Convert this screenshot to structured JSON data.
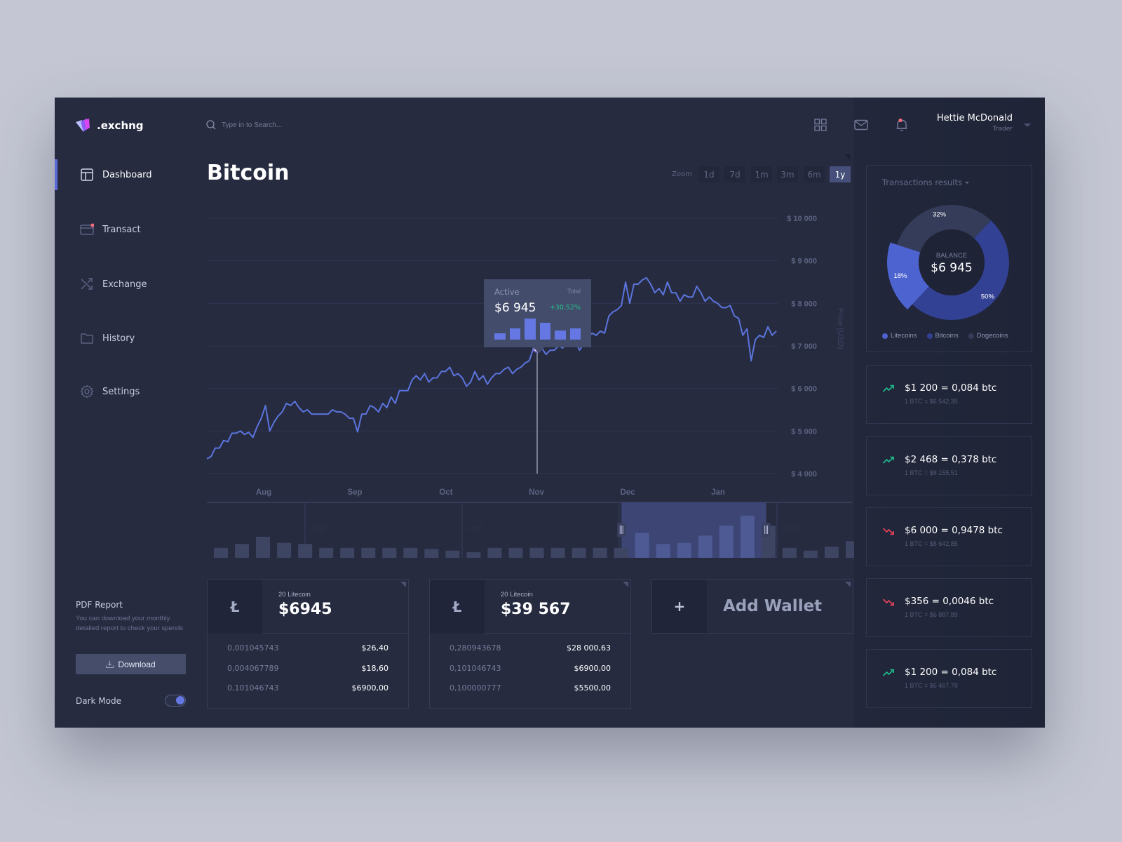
{
  "brand": {
    "name": ".exchng"
  },
  "search": {
    "placeholder": "Type in to Search..."
  },
  "header": {
    "icons": [
      "grid-icon",
      "mail-icon",
      "bell-icon"
    ],
    "user": {
      "name": "Hettie McDonald",
      "role": "Trader"
    }
  },
  "sidebar": {
    "items": [
      {
        "label": "Dashboard",
        "icon": "dashboard-icon",
        "active": true
      },
      {
        "label": "Transact",
        "icon": "card-icon",
        "badge": true
      },
      {
        "label": "Exchange",
        "icon": "shuffle-icon"
      },
      {
        "label": "History",
        "icon": "folder-icon"
      },
      {
        "label": "Settings",
        "icon": "gear-icon"
      }
    ],
    "pdf": {
      "title": "PDF Report",
      "description": "You can download your monthly detailed report to check your spends",
      "button": "Download"
    },
    "dark_mode": {
      "label": "Dark Mode",
      "on": true
    }
  },
  "main": {
    "title": "Bitcoin",
    "zoom": {
      "label": "Zoom",
      "options": [
        "1d",
        "7d",
        "1m",
        "3m",
        "6m",
        "1y"
      ],
      "selected": "1y"
    },
    "tooltip": {
      "label": "Active",
      "total_label": "Total",
      "value": "$6 945",
      "change": "+30.52%",
      "bars": [
        0.3,
        0.55,
        1.0,
        0.8,
        0.42,
        0.55
      ]
    }
  },
  "chart_data": {
    "type": "line",
    "title": "Bitcoin",
    "ylabel": "Price (USD)",
    "xlabel": "",
    "x_ticks": [
      "Aug",
      "Sep",
      "Oct",
      "Nov",
      "Dec",
      "Jan"
    ],
    "y_ticks": [
      "$ 10 000",
      "$ 9 000",
      "$ 8 000",
      "$ 7 000",
      "$ 6 000",
      "$ 5 000",
      "$ 4 000"
    ],
    "ylim": [
      4000,
      10000
    ],
    "grid": true,
    "highlight": {
      "month_position": 3.0,
      "value": 6945
    },
    "series": [
      {
        "name": "BTC",
        "color": "#5b74dc",
        "values": [
          4350,
          4400,
          4600,
          4600,
          4780,
          4750,
          4950,
          4950,
          5000,
          4920,
          4970,
          4850,
          5100,
          5300,
          5600,
          5000,
          5200,
          5350,
          5450,
          5650,
          5600,
          5700,
          5550,
          5450,
          5500,
          5400,
          5400,
          5400,
          5400,
          5400,
          5500,
          5450,
          5450,
          5400,
          5300,
          5300,
          4980,
          5400,
          5400,
          5600,
          5550,
          5450,
          5650,
          5550,
          5800,
          5650,
          5950,
          5950,
          5950,
          6200,
          6300,
          6200,
          6350,
          6150,
          6250,
          6250,
          6400,
          6400,
          6500,
          6300,
          6350,
          6250,
          6050,
          6150,
          6400,
          6200,
          6300,
          6100,
          6250,
          6350,
          6350,
          6450,
          6500,
          6350,
          6450,
          6500,
          6600,
          6650,
          6945,
          6850,
          6950,
          6800,
          6900,
          6900,
          7000,
          6950,
          7100,
          7400,
          7100,
          6900,
          7050,
          7200,
          7300,
          7250,
          7350,
          7300,
          7700,
          7800,
          7850,
          7950,
          8500,
          8000,
          8450,
          8450,
          8550,
          8600,
          8450,
          8250,
          8350,
          8200,
          8500,
          8250,
          8250,
          8050,
          8200,
          8150,
          8150,
          8400,
          8250,
          8050,
          8150,
          8050,
          8000,
          7900,
          7900,
          7950,
          7700,
          7650,
          7250,
          7400,
          6650,
          7150,
          7250,
          7200,
          7450,
          7250,
          7350
        ]
      }
    ],
    "navigator": {
      "year_labels": [
        "2016",
        "2017",
        "2018",
        "2019"
      ],
      "bars": [
        0.18,
        0.25,
        0.38,
        0.27,
        0.25,
        0.18,
        0.18,
        0.18,
        0.18,
        0.18,
        0.16,
        0.13,
        0.1,
        0.18,
        0.18,
        0.18,
        0.18,
        0.18,
        0.18,
        0.18,
        0.45,
        0.25,
        0.27,
        0.4,
        0.58,
        0.76,
        0.58,
        0.18,
        0.13,
        0.2,
        0.3
      ],
      "selection": [
        0.642,
        0.866
      ]
    }
  },
  "wallets": [
    {
      "icon": "litecoin-icon",
      "glyph": "Ł",
      "subtitle": "20 Litecoin",
      "amount": "$6945",
      "rows": [
        {
          "qty": "0,001045743",
          "value": "$26,40"
        },
        {
          "qty": "0,004067789",
          "value": "$18,60"
        },
        {
          "qty": "0,101046743",
          "value": "$6900,00"
        }
      ]
    },
    {
      "icon": "litecoin-icon",
      "glyph": "Ł",
      "subtitle": "20 Litecoin",
      "amount": "$39 567",
      "rows": [
        {
          "qty": "0,280943678",
          "value": "$28 000,63"
        },
        {
          "qty": "0,101046743",
          "value": "$6900,00"
        },
        {
          "qty": "0,100000777",
          "value": "$5500,00"
        }
      ]
    }
  ],
  "add_wallet": {
    "glyph": "+",
    "label": "Add Wallet"
  },
  "transactions": {
    "title": "Transactions results",
    "balance_label": "BALANCE",
    "balance": "$6 945",
    "donut": [
      {
        "name": "Dogecoins",
        "percent": 32,
        "label": "32%",
        "color": "#343c59"
      },
      {
        "name": "Bitcoins",
        "percent": 50,
        "label": "50%",
        "color": "#324194"
      },
      {
        "name": "Litecoins",
        "percent": 18,
        "label": "18%",
        "color": "#4d63cf"
      }
    ],
    "legend": [
      {
        "name": "Litecoins",
        "color": "#4d63cf"
      },
      {
        "name": "Bitcoins",
        "color": "#324194"
      },
      {
        "name": "Dogecoins",
        "color": "#343c59"
      }
    ]
  },
  "conversions": [
    {
      "main": "$1 200 = 0,084 btc",
      "rate": "1 BTC = $6 542,35",
      "trend": "up"
    },
    {
      "main": "$2 468 = 0,378 btc",
      "rate": "1 BTC = $8 155,51",
      "trend": "up"
    },
    {
      "main": "$6 000 = 0,9478 btc",
      "rate": "1 BTC = $8 642,85",
      "trend": "down"
    },
    {
      "main": "$356 = 0,0046 btc",
      "rate": "1 BTC = $6 887,89",
      "trend": "down"
    },
    {
      "main": "$1 200 = 0,084 btc",
      "rate": "1 BTC = $6 467,78",
      "trend": "up"
    }
  ],
  "colors": {
    "accent": "#5b6ad8",
    "up": "#1fbf8f",
    "down": "#f0445a",
    "line": "#5b74dc"
  }
}
